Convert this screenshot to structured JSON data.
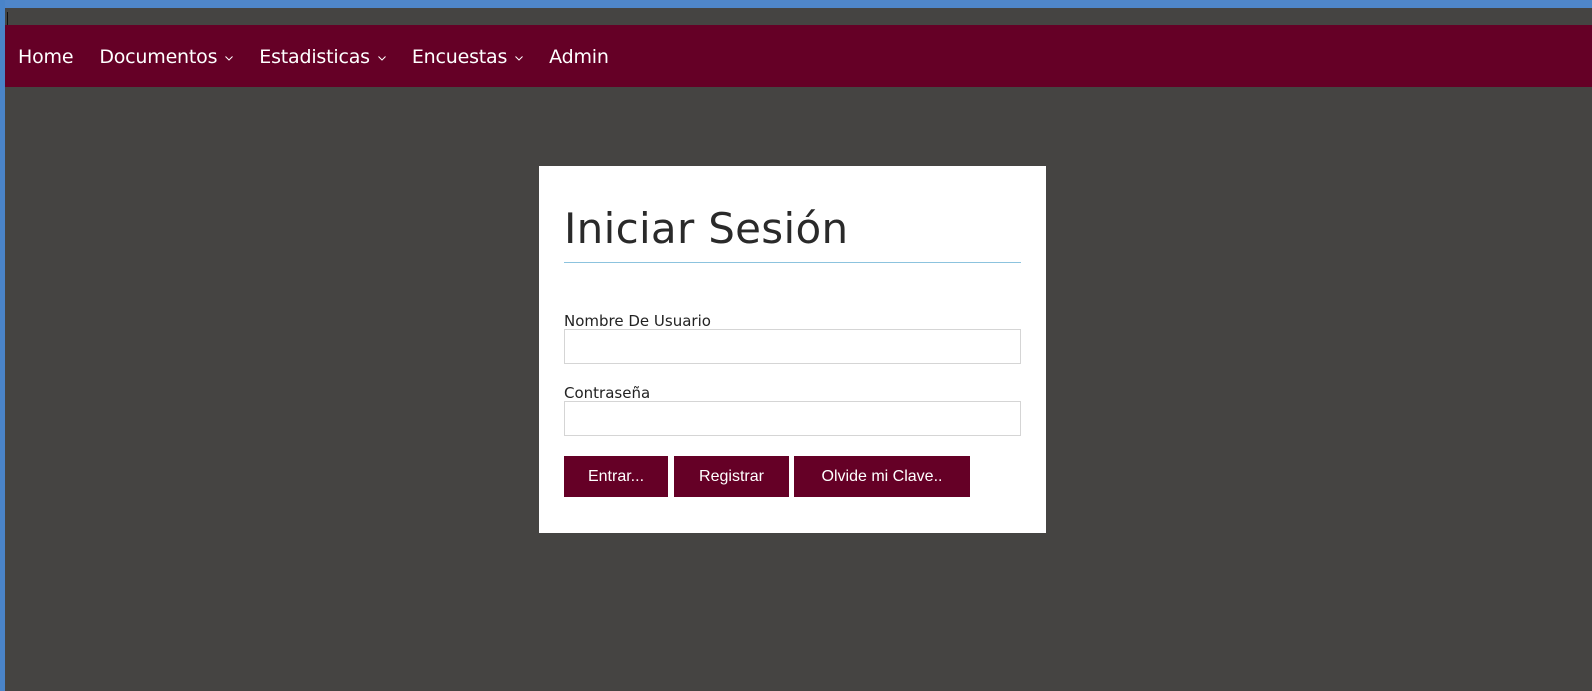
{
  "colors": {
    "brand": "#650026",
    "page_background": "#454442",
    "window_frame": "#4a84c8",
    "title_rule": "#8cc3de"
  },
  "nav": {
    "items": [
      {
        "label": "Home",
        "has_dropdown": false
      },
      {
        "label": "Documentos",
        "has_dropdown": true
      },
      {
        "label": "Estadisticas",
        "has_dropdown": true
      },
      {
        "label": "Encuestas",
        "has_dropdown": true
      },
      {
        "label": "Admin",
        "has_dropdown": false
      }
    ]
  },
  "login": {
    "title": "Iniciar Sesión",
    "username": {
      "label": "Nombre De Usuario",
      "value": "",
      "placeholder": ""
    },
    "password": {
      "label": "Contraseña",
      "value": "",
      "placeholder": ""
    },
    "buttons": {
      "submit": "Entrar...",
      "register": "Registrar",
      "forgot": "Olvide mi Clave.."
    }
  }
}
